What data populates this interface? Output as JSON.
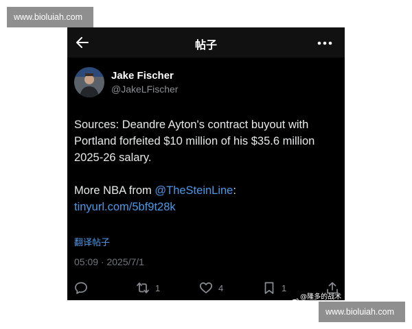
{
  "watermark": {
    "text": "www.bioluiah.com"
  },
  "topbar": {
    "title": "帖子",
    "back_icon": "arrow-left-icon",
    "more_icon": "more-horizontal-icon"
  },
  "author": {
    "display_name": "Jake Fischer",
    "handle": "@JakeLFischer",
    "avatar_icon": "profile-photo"
  },
  "tweet": {
    "paragraph1": "Sources: Deandre Ayton's contract buyout with Portland forfeited $10 million of his $35.6 million 2025-26 salary.",
    "paragraph2_prefix": "More NBA from ",
    "mention": "@TheSteinLine",
    "separator": ": ",
    "url": "tinyurl.com/5bf9t28k"
  },
  "translate_label": "翻译帖子",
  "timestamp": "05:09 · 2025/7/1",
  "actions": {
    "reply": {
      "icon": "reply-icon",
      "count": ""
    },
    "retweet": {
      "icon": "retweet-icon",
      "count": "1"
    },
    "like": {
      "icon": "heart-icon",
      "count": "4"
    },
    "bookmark": {
      "icon": "bookmark-icon",
      "count": "1"
    },
    "share": {
      "icon": "share-icon"
    }
  },
  "source_badge": "@隆多的战术板",
  "colors": {
    "background": "#000000",
    "link": "#4a99e9",
    "muted": "#71767b",
    "text": "#e7e9ea"
  }
}
